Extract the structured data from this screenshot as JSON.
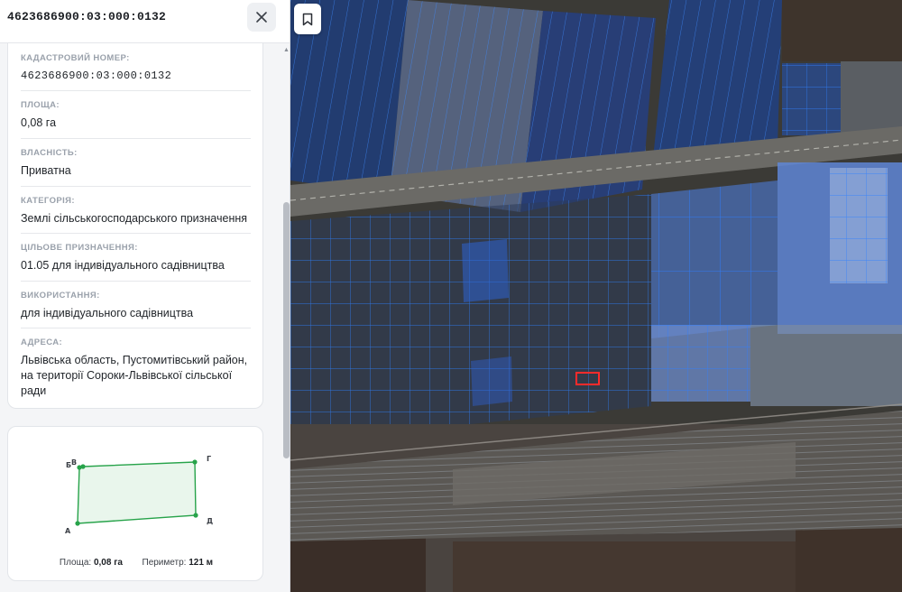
{
  "header": {
    "title": "4623686900:03:000:0132"
  },
  "details": [
    {
      "label": "КАДАСТРОВИЙ НОМЕР:",
      "value": "4623686900:03:000:0132"
    },
    {
      "label": "ПЛОЩА:",
      "value": "0,08 га"
    },
    {
      "label": "ВЛАСНІСТЬ:",
      "value": "Приватна"
    },
    {
      "label": "КАТЕГОРІЯ:",
      "value": "Землі сільськогосподарського призначення"
    },
    {
      "label": "ЦІЛЬОВЕ ПРИЗНАЧЕННЯ:",
      "value": "01.05 для індивідуального садівництва"
    },
    {
      "label": "ВИКОРИСТАННЯ:",
      "value": "для індивідуального садівництва"
    },
    {
      "label": "АДРЕСА:",
      "value": "Львівська область, Пустомитівський район, на території Сороки-Львівської сільської ради"
    }
  ],
  "shape": {
    "vertices": [
      "Б",
      "В",
      "Г",
      "Д",
      "А"
    ],
    "area_label": "Площа:",
    "area_value": "0,08 га",
    "perimeter_label": "Периметр:",
    "perimeter_value": "121 м"
  },
  "icons": {
    "close": "close-icon",
    "bookmark": "bookmark-icon",
    "scroll_up": "chevron-up-icon"
  },
  "colors": {
    "parcel_outline": "#2f7fff",
    "parcel_fill": "#3a7bff",
    "selected_parcel": "#ff2b2b",
    "shape_stroke": "#27a34a",
    "shape_fill": "#e9f6ec"
  }
}
